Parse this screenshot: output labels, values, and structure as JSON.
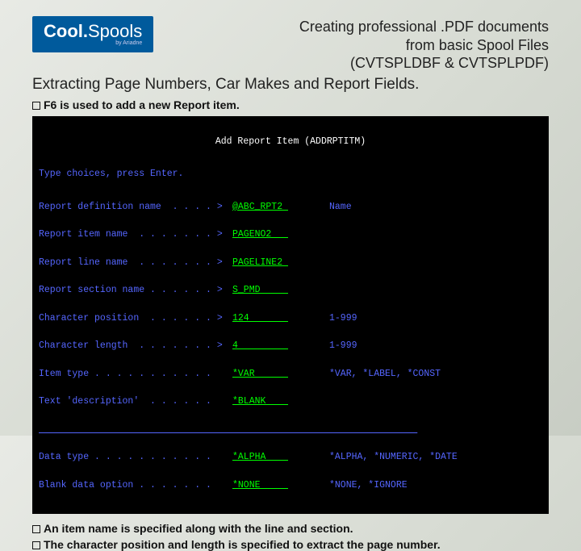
{
  "logo": {
    "part1": "Cool.",
    "part2": "Spools",
    "sub": "by Ariadne"
  },
  "title": {
    "line1": "Creating professional .PDF documents",
    "line2": "from basic Spool Files",
    "line3": "(CVTSPLDBF & CVTSPLPDF)"
  },
  "subtitle": "Extracting Page Numbers, Car Makes and Report Fields.",
  "bullets": {
    "top": "F6 is used to add a new Report item.",
    "b1": "An item name is specified along with the line and section.",
    "b2": "The character position and length is specified to extract the page number."
  },
  "terminal": {
    "title": "Add Report Item (ADDRPTITM)",
    "instr": "Type choices, press Enter.",
    "rows": [
      {
        "label": "Report definition name  . . . . >",
        "value": "@ABC_RPT2 ",
        "hint": "Name"
      },
      {
        "label": "Report item name  . . . . . . . >",
        "value": "PAGENO2   ",
        "hint": ""
      },
      {
        "label": "Report line name  . . . . . . . >",
        "value": "PAGELINE2 ",
        "hint": ""
      },
      {
        "label": "Report section name . . . . . . >",
        "value": "S_PMD     ",
        "hint": ""
      },
      {
        "label": "Character position  . . . . . . >",
        "value": "124       ",
        "hint": "1-999"
      },
      {
        "label": "Character length  . . . . . . . >",
        "value": "4         ",
        "hint": "1-999"
      },
      {
        "label": "Item type . . . . . . . . . . .  ",
        "value": "*VAR      ",
        "hint": "*VAR, *LABEL, *CONST"
      },
      {
        "label": "Text 'description'  . . . . . .  ",
        "value": "*BLANK    ",
        "hint": ""
      }
    ],
    "sep": "                                                                    ",
    "rows2": [
      {
        "label": "Data type . . . . . . . . . . .  ",
        "value": "*ALPHA    ",
        "hint": "*ALPHA, *NUMERIC, *DATE"
      },
      {
        "label": "Blank data option . . . . . . .  ",
        "value": "*NONE     ",
        "hint": "*NONE, *IGNORE"
      }
    ]
  }
}
